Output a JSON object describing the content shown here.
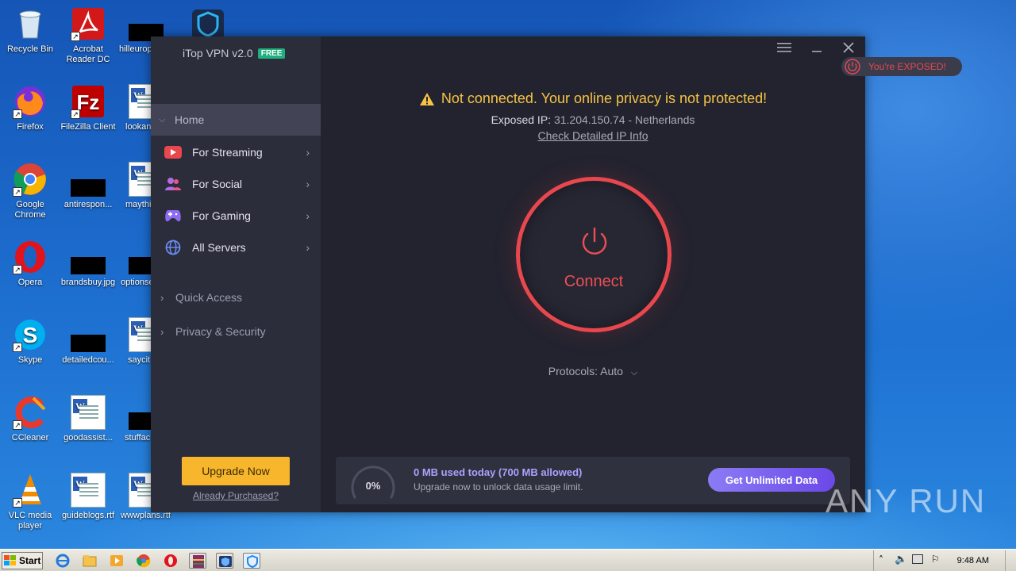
{
  "desktop": {
    "icons": [
      {
        "label": "Recycle Bin"
      },
      {
        "label": "Acrobat Reader DC"
      },
      {
        "label": "hilleurop"
      },
      {
        "label": "Firefox"
      },
      {
        "label": "FileZilla Client"
      },
      {
        "label": "lookan"
      },
      {
        "label": "Google Chrome"
      },
      {
        "label": "antirespon..."
      },
      {
        "label": "maythi"
      },
      {
        "label": "Opera"
      },
      {
        "label": "brandsbuy.jpg"
      },
      {
        "label": "optionse"
      },
      {
        "label": "Skype"
      },
      {
        "label": "detailedcou..."
      },
      {
        "label": "saycit"
      },
      {
        "label": "CCleaner"
      },
      {
        "label": "goodassist..."
      },
      {
        "label": "stuffac"
      },
      {
        "label": "VLC media player"
      },
      {
        "label": "guideblogs.rtf"
      },
      {
        "label": "wwwplans.rtf"
      }
    ]
  },
  "app": {
    "title": "iTop VPN v2.0",
    "badge": "FREE",
    "colors": {
      "accent": "#e9474e",
      "warning": "#f6c343",
      "upgrade": "#f7b62c",
      "purple": "#7a5cf0",
      "free": "#1fae7d"
    },
    "sidebar": {
      "home": "Home",
      "items": [
        {
          "label": "For Streaming",
          "icon": "play-icon"
        },
        {
          "label": "For Social",
          "icon": "people-icon"
        },
        {
          "label": "For Gaming",
          "icon": "gamepad-icon"
        },
        {
          "label": "All Servers",
          "icon": "globe-icon"
        }
      ],
      "sections": [
        "Quick Access",
        "Privacy & Security"
      ],
      "upgrade": "Upgrade Now",
      "purchased": "Already Purchased?"
    },
    "status": {
      "message": "Not connected. Your online privacy is not protected!",
      "ip_label": "Exposed IP:",
      "ip_value": "31.204.150.74 - Netherlands",
      "ip_link": "Check Detailed IP Info"
    },
    "connect_label": "Connect",
    "protocols": "Protocols: Auto",
    "usage": {
      "percent": "0%",
      "title": "0 MB used today (700 MB allowed)",
      "subtitle": "Upgrade now to unlock data usage limit.",
      "button": "Get Unlimited Data"
    }
  },
  "exposed_badge": "You're EXPOSED!",
  "watermark": "ANY RUN",
  "taskbar": {
    "start": "Start",
    "clock": "9:48 AM"
  }
}
